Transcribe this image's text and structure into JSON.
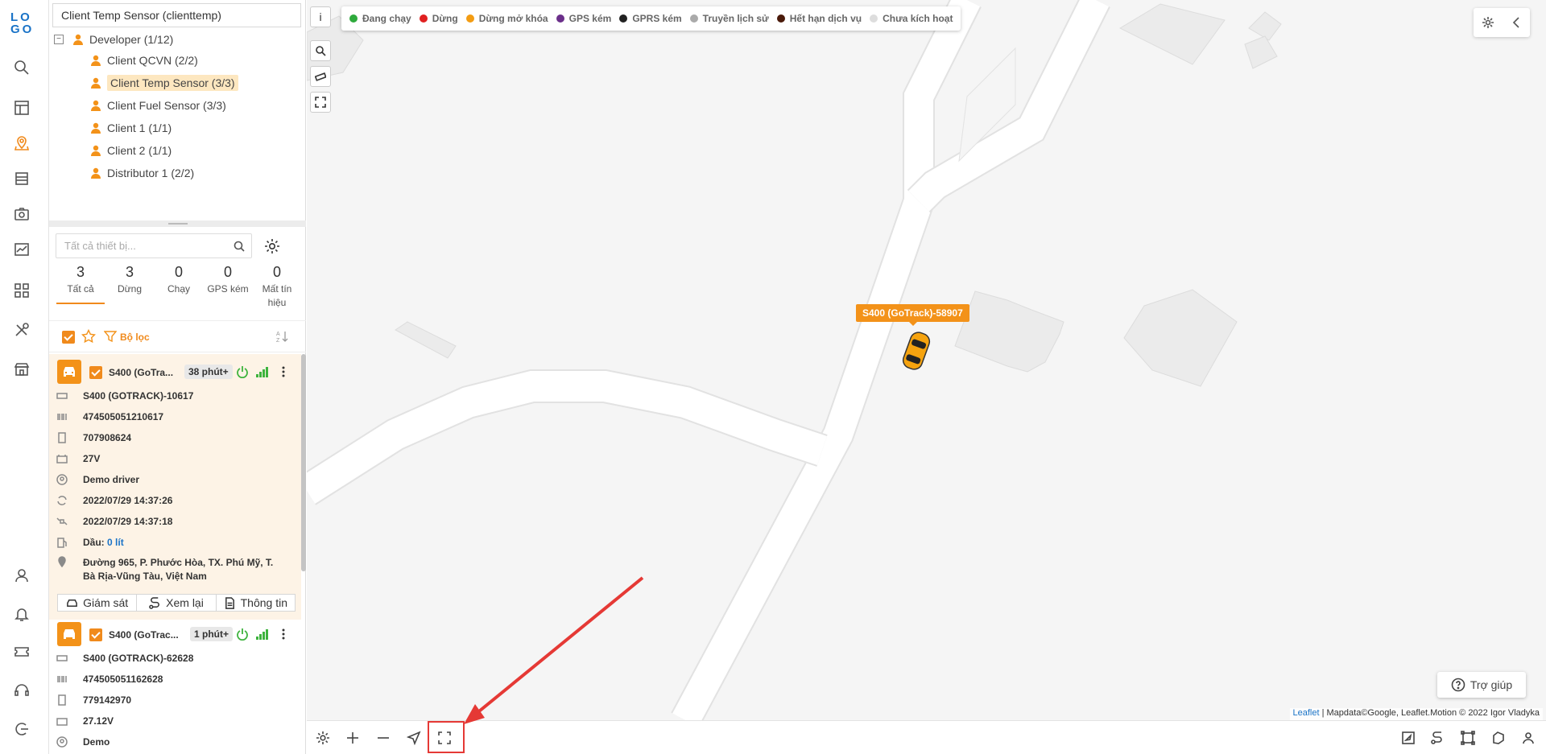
{
  "sidebar": {
    "logo": [
      "LO",
      "GO"
    ]
  },
  "tree": {
    "search_value": "Client Temp Sensor (clienttemp)",
    "root": "Developer (1/12)",
    "items": [
      "Client QCVN (2/2)",
      "Client Temp Sensor (3/3)",
      "Client Fuel Sensor (3/3)",
      "Client 1 (1/1)",
      "Client 2 (1/1)",
      "Distributor 1 (2/2)"
    ]
  },
  "devices": {
    "search_placeholder": "Tất cả thiết bị...",
    "stats": [
      {
        "n": "3",
        "l": "Tất cả"
      },
      {
        "n": "3",
        "l": "Dừng"
      },
      {
        "n": "0",
        "l": "Chạy"
      },
      {
        "n": "0",
        "l": "GPS kém"
      },
      {
        "n": "0",
        "l": "Mất tín hiệu"
      }
    ],
    "filter_label": "Bộ lọc",
    "cards": [
      {
        "name": "S400 (GoTra...",
        "badge": "38 phút+",
        "imei_label": "S400 (GOTRACK)-10617",
        "code": "474505051210617",
        "phone": "707908624",
        "voltage": "27V",
        "driver": "Demo driver",
        "time1": "2022/07/29 14:37:26",
        "time2": "2022/07/29 14:37:18",
        "fuel_label": "Dầu:",
        "fuel_value": "0 lít",
        "address": "Đường 965, P. Phước Hòa, TX. Phú Mỹ, T. Bà Rịa-Vũng Tàu, Việt Nam",
        "actions": [
          "Giám sát",
          "Xem lại",
          "Thông tin"
        ]
      },
      {
        "name": "S400 (GoTrac...",
        "badge": "1 phút+",
        "imei_label": "S400 (GOTRACK)-62628",
        "code": "474505051162628",
        "phone": "779142970",
        "voltage": "27.12V",
        "driver": "Demo"
      }
    ]
  },
  "map": {
    "info_button": "i",
    "legend": [
      {
        "label": "Đang chạy",
        "color": "#2eaa3c"
      },
      {
        "label": "Dừng",
        "color": "#e02020"
      },
      {
        "label": "Dừng mở khóa",
        "color": "#f39c12"
      },
      {
        "label": "GPS kém",
        "color": "#6b2f8a"
      },
      {
        "label": "GPRS kém",
        "color": "#222222"
      },
      {
        "label": "Truyền lịch sử",
        "color": "#aaaaaa"
      },
      {
        "label": "Hết hạn dịch vụ",
        "color": "#4a1a0a"
      },
      {
        "label": "Chưa kích hoạt",
        "color": "#dddddd"
      }
    ],
    "marker_label": "S400 (GoTrack)-58907",
    "help_label": "Trợ giúp",
    "attribution_link": "Leaflet",
    "attribution_text": "| Mapdata©Google, Leaflet.Motion © 2022 Igor Vladyka"
  },
  "colors": {
    "accent": "#f39219",
    "annotation": "#e53935"
  }
}
